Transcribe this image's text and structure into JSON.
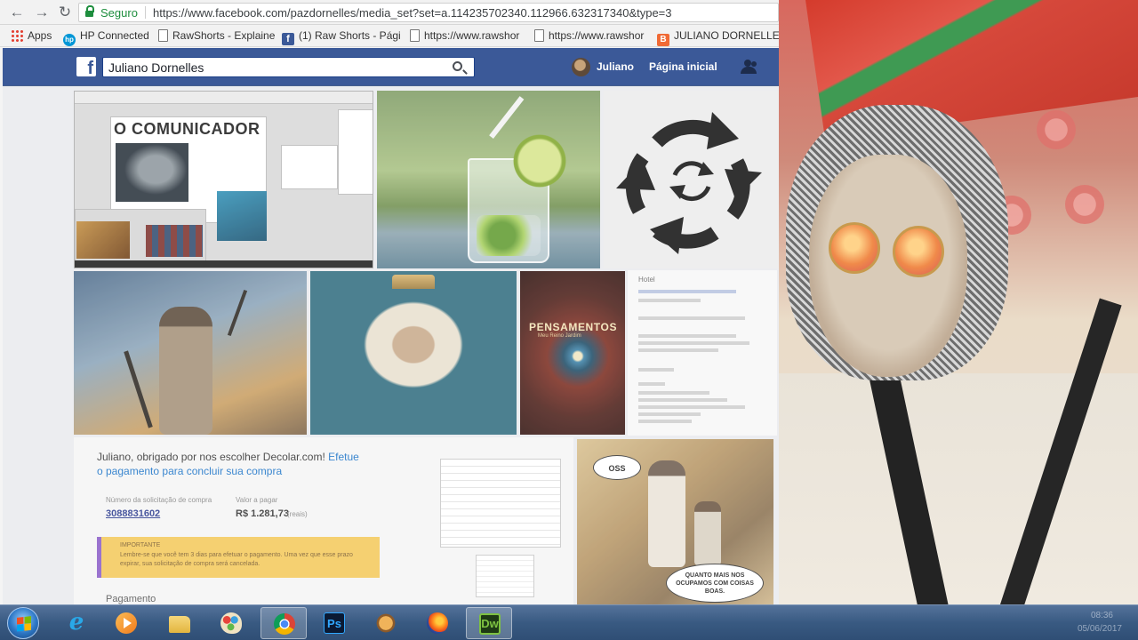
{
  "browser": {
    "secure_label": "Seguro",
    "url": "https://www.facebook.com/pazdornelles/media_set?set=a.114235702340.112966.632317340&type=3",
    "bookmarks": [
      {
        "label": "Apps",
        "icon": "apps-grid-icon"
      },
      {
        "label": "HP Connected",
        "icon": "hp-logo-icon"
      },
      {
        "label": "RawShorts - Explaine",
        "icon": "page-icon"
      },
      {
        "label": "(1) Raw Shorts - Pági",
        "icon": "facebook-icon"
      },
      {
        "label": "https://www.rawshor",
        "icon": "page-icon"
      },
      {
        "label": "https://www.rawshor",
        "icon": "page-icon"
      },
      {
        "label": "JULIANO DORNELLES",
        "icon": "blogger-icon"
      }
    ]
  },
  "facebook": {
    "logo": "f",
    "search_value": "Juliano Dornelles",
    "user_name": "Juliano",
    "home_link": "Página inicial"
  },
  "photos": {
    "comunicador_title": "O COMUNICADOR",
    "pensamentos_title": "PENSAMENTOS",
    "pensamentos_subtitle": "Meu Reino Jardim",
    "decolar": {
      "message": "Juliano, obrigado por nos escolher Decolar.com!",
      "link": "Efetue o pagamento para concluir sua compra",
      "order_label": "Número da solicitação de compra",
      "order_number": "3088831602",
      "amount_label": "Valor a pagar",
      "amount_value": "R$ 1.281,73",
      "amount_note": "(reais)",
      "important_title": "IMPORTANTE",
      "important_text": "Lembre-se que você tem 3 dias para efetuar o pagamento. Uma vez que esse prazo expirar, sua solicitação de compra será cancelada.",
      "payment_label": "Pagamento"
    },
    "comic": {
      "speech_os": "OSS",
      "speech_quote": "QUANTO MAIS NOS OCUPAMOS COM COISAS BOAS."
    },
    "side_info_title": "Hotel"
  },
  "taskbar": {
    "apps": [
      {
        "name": "internet-explorer",
        "label": "e"
      },
      {
        "name": "media-player",
        "label": ""
      },
      {
        "name": "file-explorer",
        "label": ""
      },
      {
        "name": "paint",
        "label": ""
      },
      {
        "name": "chrome",
        "label": ""
      },
      {
        "name": "photoshop",
        "label": "Ps"
      },
      {
        "name": "gimp",
        "label": ""
      },
      {
        "name": "firefox",
        "label": ""
      },
      {
        "name": "dreamweaver",
        "label": "Dw"
      }
    ],
    "clock_time": "08:36",
    "clock_date": "05/06/2017"
  },
  "colors": {
    "facebook_blue": "#3b5998",
    "secure_green": "#1e8e3e",
    "taskbar": "#395a82"
  }
}
